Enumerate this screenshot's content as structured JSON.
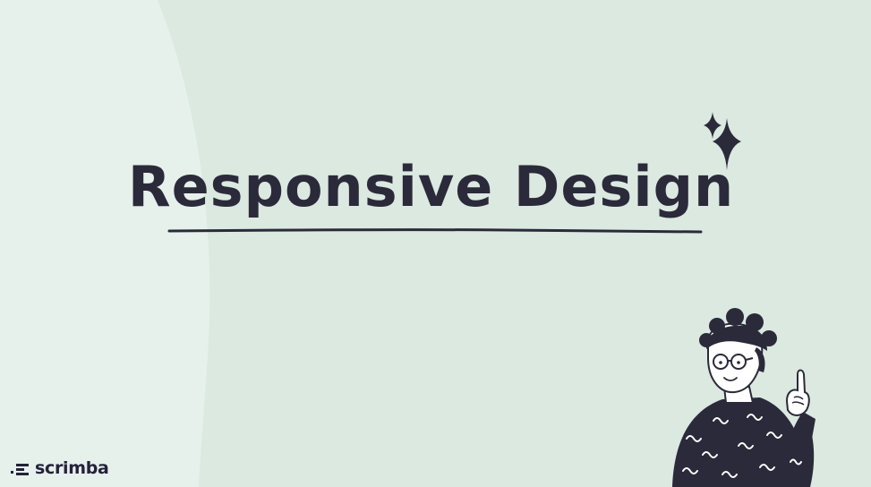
{
  "slide": {
    "title": "Responsive Design"
  },
  "brand": {
    "name": "scrimba",
    "logo_icon": "scrimba-logo-icon"
  },
  "decorations": {
    "sparkle_icon": "sparkles-icon",
    "character_illustration": "pointing-character-illustration"
  },
  "colors": {
    "background": "#dbe9e0",
    "background_light": "#e7f1ec",
    "ink": "#2b2a3a"
  }
}
